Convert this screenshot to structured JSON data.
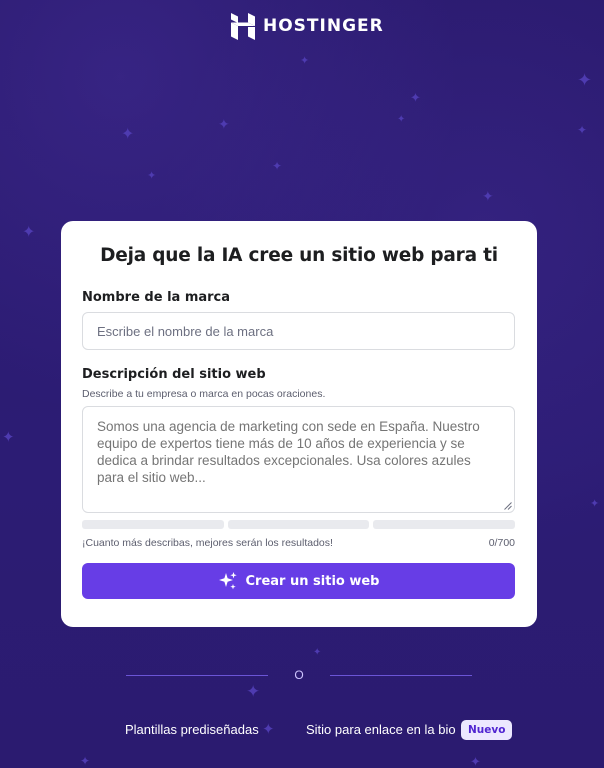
{
  "brand": {
    "name": "HOSTINGER",
    "icon": "hostinger-logo",
    "colors": {
      "background": "#2a1b6e",
      "accent": "#673de6",
      "badge_bg": "#ece8ff",
      "badge_text": "#5025d1"
    }
  },
  "card": {
    "title": "Deja que la IA cree un sitio web para ti",
    "brand_name": {
      "label": "Nombre de la marca",
      "placeholder": "Escribe el nombre de la marca",
      "value": ""
    },
    "description": {
      "label": "Descripción del sitio web",
      "helper": "Describe a tu empresa o marca en pocas oraciones.",
      "placeholder": "Somos una agencia de marketing con sede en España. Nuestro equipo de expertos tiene más de 10 años de experiencia y se dedica a brindar resultados excepcionales. Usa colores azules para el sitio web...",
      "value": ""
    },
    "progress": {
      "segments": 3,
      "filled_fraction": 0
    },
    "hint": "¡Cuanto más describas, mejores serán los resultados!",
    "counter": "0/700",
    "cta": {
      "label": "Crear un sitio web",
      "icon": "sparkles-icon"
    }
  },
  "divider": {
    "text": "O"
  },
  "bottom_links": {
    "templates": "Plantillas prediseñadas",
    "bio_site": "Sitio para enlace en la bio",
    "bio_badge": "Nuevo"
  },
  "decor": {
    "icon": "sparkle-star-icon"
  }
}
